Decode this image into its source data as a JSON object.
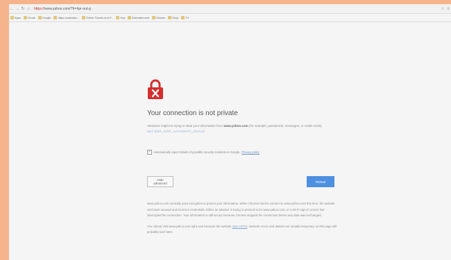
{
  "browser": {
    "url_secure_label": "https://",
    "url_host": "www.yahoo.com",
    "url_path": "/?fr=hpr-out-g"
  },
  "bookmarks": [
    {
      "label": "Apps"
    },
    {
      "label": "Gmail"
    },
    {
      "label": "Google"
    },
    {
      "label": "https://calendar..."
    },
    {
      "label": "Online Tickets and P..."
    },
    {
      "label": "Key"
    },
    {
      "label": "Entertainment"
    },
    {
      "label": "Movies"
    },
    {
      "label": "Shop"
    },
    {
      "label": "TV"
    }
  ],
  "error": {
    "title": "Your connection is not private",
    "desc_prefix": "Attackers might be trying to steal your information from",
    "desc_host": "www.yahoo.com",
    "desc_suffix": "(for example, passwords, messages, or credit cards).",
    "learn_more": "NET::ERR_CERT_AUTHORITY_INVALID",
    "checkbox_label": "Automatically report details of possible security incidents to Google.",
    "privacy_link": "Privacy policy",
    "advanced_button": "Hide advanced",
    "back_button": "Reload",
    "details_para1": "www.yahoo.com normally uses encryption to protect your information. When Chrome tried to connect to www.yahoo.com this time, the website sent back unusual and incorrect credentials. Either an attacker is trying to pretend to be www.yahoo.com, or a Wi-Fi sign-in screen has interrupted the connection. Your information is still secure because Chrome stopped the connection before any data was exchanged.",
    "details_para2_prefix": "You cannot visit www.yahoo.com right now because the website",
    "hsts_link": "uses HSTS",
    "details_para2_suffix": ". Network errors and attacks are usually temporary, so this page will probably work later."
  },
  "colors": {
    "lock_red": "#d32f2f",
    "primary_blue": "#4d8fe0"
  }
}
